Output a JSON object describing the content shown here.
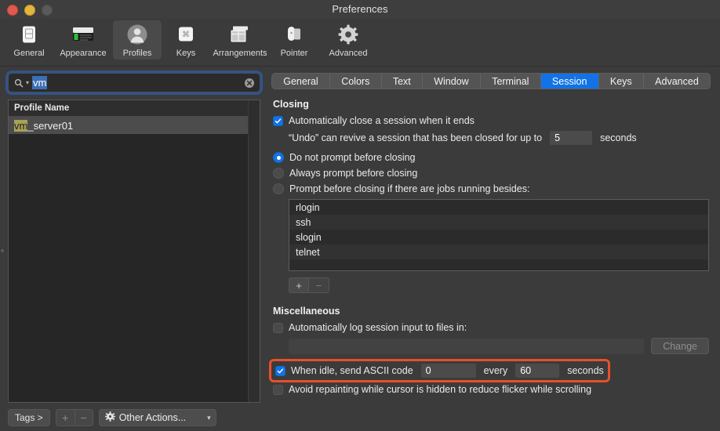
{
  "window": {
    "title": "Preferences",
    "traffic": {
      "close": "close-button",
      "minimize": "minimize-button",
      "zoom": "zoom-button"
    }
  },
  "toolbar": {
    "items": [
      {
        "label": "General",
        "icon": "general-icon"
      },
      {
        "label": "Appearance",
        "icon": "appearance-icon"
      },
      {
        "label": "Profiles",
        "icon": "profiles-icon",
        "selected": true
      },
      {
        "label": "Keys",
        "icon": "keys-icon"
      },
      {
        "label": "Arrangements",
        "icon": "arrangements-icon"
      },
      {
        "label": "Pointer",
        "icon": "pointer-icon"
      },
      {
        "label": "Advanced",
        "icon": "advanced-icon"
      }
    ]
  },
  "sidebar": {
    "search": {
      "value": "vm",
      "placeholder": "",
      "icon": "search-icon",
      "clear_icon": "clear-icon"
    },
    "list": {
      "header": "Profile Name",
      "rows": [
        {
          "match": "vm",
          "rest": "_server01",
          "selected": true
        }
      ]
    },
    "footer": {
      "tags_label": "Tags >",
      "add_label": "+",
      "remove_label": "−",
      "other_actions_label": "Other Actions...",
      "other_actions_icon": "gear-icon",
      "chevron": "⌄"
    }
  },
  "tabs": [
    {
      "label": "General",
      "active": false
    },
    {
      "label": "Colors",
      "active": false
    },
    {
      "label": "Text",
      "active": false
    },
    {
      "label": "Window",
      "active": false
    },
    {
      "label": "Terminal",
      "active": false
    },
    {
      "label": "Session",
      "active": true
    },
    {
      "label": "Keys",
      "active": false
    },
    {
      "label": "Advanced",
      "active": false
    }
  ],
  "session": {
    "closing": {
      "title": "Closing",
      "auto_close": {
        "label": "Automatically close a session when it ends",
        "checked": true
      },
      "undo": {
        "prefix": "“Undo” can revive a session that has been closed for up to",
        "value": "5",
        "suffix": "seconds"
      },
      "radios": [
        {
          "label": "Do not prompt before closing",
          "selected": true
        },
        {
          "label": "Always prompt before closing",
          "selected": false
        },
        {
          "label": "Prompt before closing if there are jobs running besides:",
          "selected": false
        }
      ],
      "jobs": [
        "rlogin",
        "ssh",
        "slogin",
        "telnet"
      ],
      "add_label": "+",
      "remove_label": "−"
    },
    "misc": {
      "title": "Miscellaneous",
      "auto_log": {
        "label": "Automatically log session input to files in:",
        "checked": false
      },
      "log_path": "",
      "change_label": "Change",
      "idle": {
        "checked": true,
        "prefix": "When idle, send ASCII code",
        "code": "0",
        "mid": "every",
        "interval": "60",
        "suffix": "seconds"
      },
      "avoid_repaint": {
        "label": "Avoid repainting while cursor is hidden to reduce flicker while scrolling",
        "checked": false
      }
    }
  },
  "colors": {
    "accent": "#1273e6",
    "highlight_box": "#e8502a",
    "match_highlight": "#a9a05a",
    "selection": "#3d6fb5"
  }
}
